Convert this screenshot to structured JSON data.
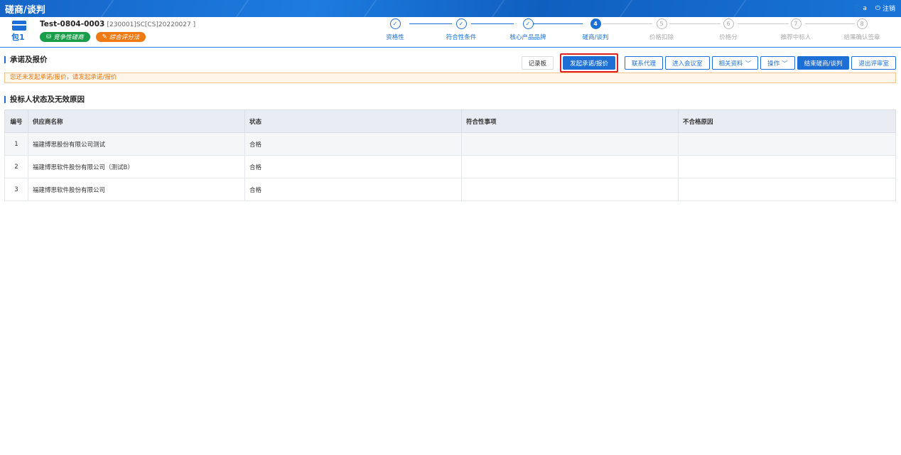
{
  "topbar": {
    "title": "磋商/谈判",
    "user": "a",
    "logout": "注销"
  },
  "header": {
    "package_label": "包1",
    "project_title": "Test-0804-0003",
    "project_code": "[230001]SC[CS]20220027 ]",
    "tag_green": "竞争性磋商",
    "tag_orange": "综合评分法"
  },
  "steps": [
    {
      "num": "✓",
      "label": "资格性",
      "state": "done"
    },
    {
      "num": "✓",
      "label": "符合性条件",
      "state": "done"
    },
    {
      "num": "✓",
      "label": "核心产品品牌",
      "state": "done"
    },
    {
      "num": "4",
      "label": "磋商/谈判",
      "state": "current"
    },
    {
      "num": "5",
      "label": "价格扣除",
      "state": "todo"
    },
    {
      "num": "6",
      "label": "价格分",
      "state": "todo"
    },
    {
      "num": "7",
      "label": "推荐中标人",
      "state": "todo"
    },
    {
      "num": "8",
      "label": "结果确认签章",
      "state": "todo"
    }
  ],
  "section1": {
    "title": "承诺及报价"
  },
  "buttons": {
    "record": "记录板",
    "initiate": "发起承诺/报价",
    "contact": "联系代理",
    "enter_room": "进入会议室",
    "materials": "相关资料",
    "operate": "操作",
    "finish": "结束磋商/谈判",
    "exit_room": "退出评审室"
  },
  "warning": "您还未发起承诺/报价，请发起承诺/报价",
  "section2": {
    "title": "投标人状态及无效原因"
  },
  "table": {
    "headers": [
      "编号",
      "供应商名称",
      "状态",
      "符合性事项",
      "不合格原因"
    ],
    "rows": [
      [
        "1",
        "福建博思股份有限公司测试",
        "合格",
        "",
        ""
      ],
      [
        "2",
        "福建博思软件股份有限公司（测试B）",
        "合格",
        "",
        ""
      ],
      [
        "3",
        "福建博思软件股份有限公司",
        "合格",
        "",
        ""
      ]
    ]
  }
}
